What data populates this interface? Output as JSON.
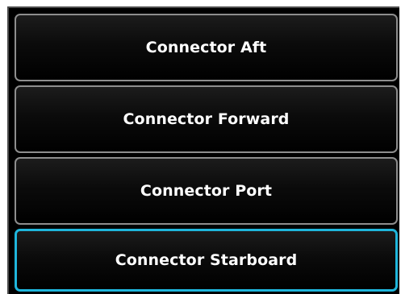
{
  "list": {
    "items": [
      {
        "label": "Connector Aft",
        "selected": false
      },
      {
        "label": "Connector Forward",
        "selected": false
      },
      {
        "label": "Connector Port",
        "selected": false
      },
      {
        "label": "Connector Starboard",
        "selected": true
      }
    ]
  },
  "colors": {
    "background": "#000000",
    "button_border": "#8e8e8e",
    "selected_border": "#1fb6dc",
    "text": "#ffffff"
  }
}
